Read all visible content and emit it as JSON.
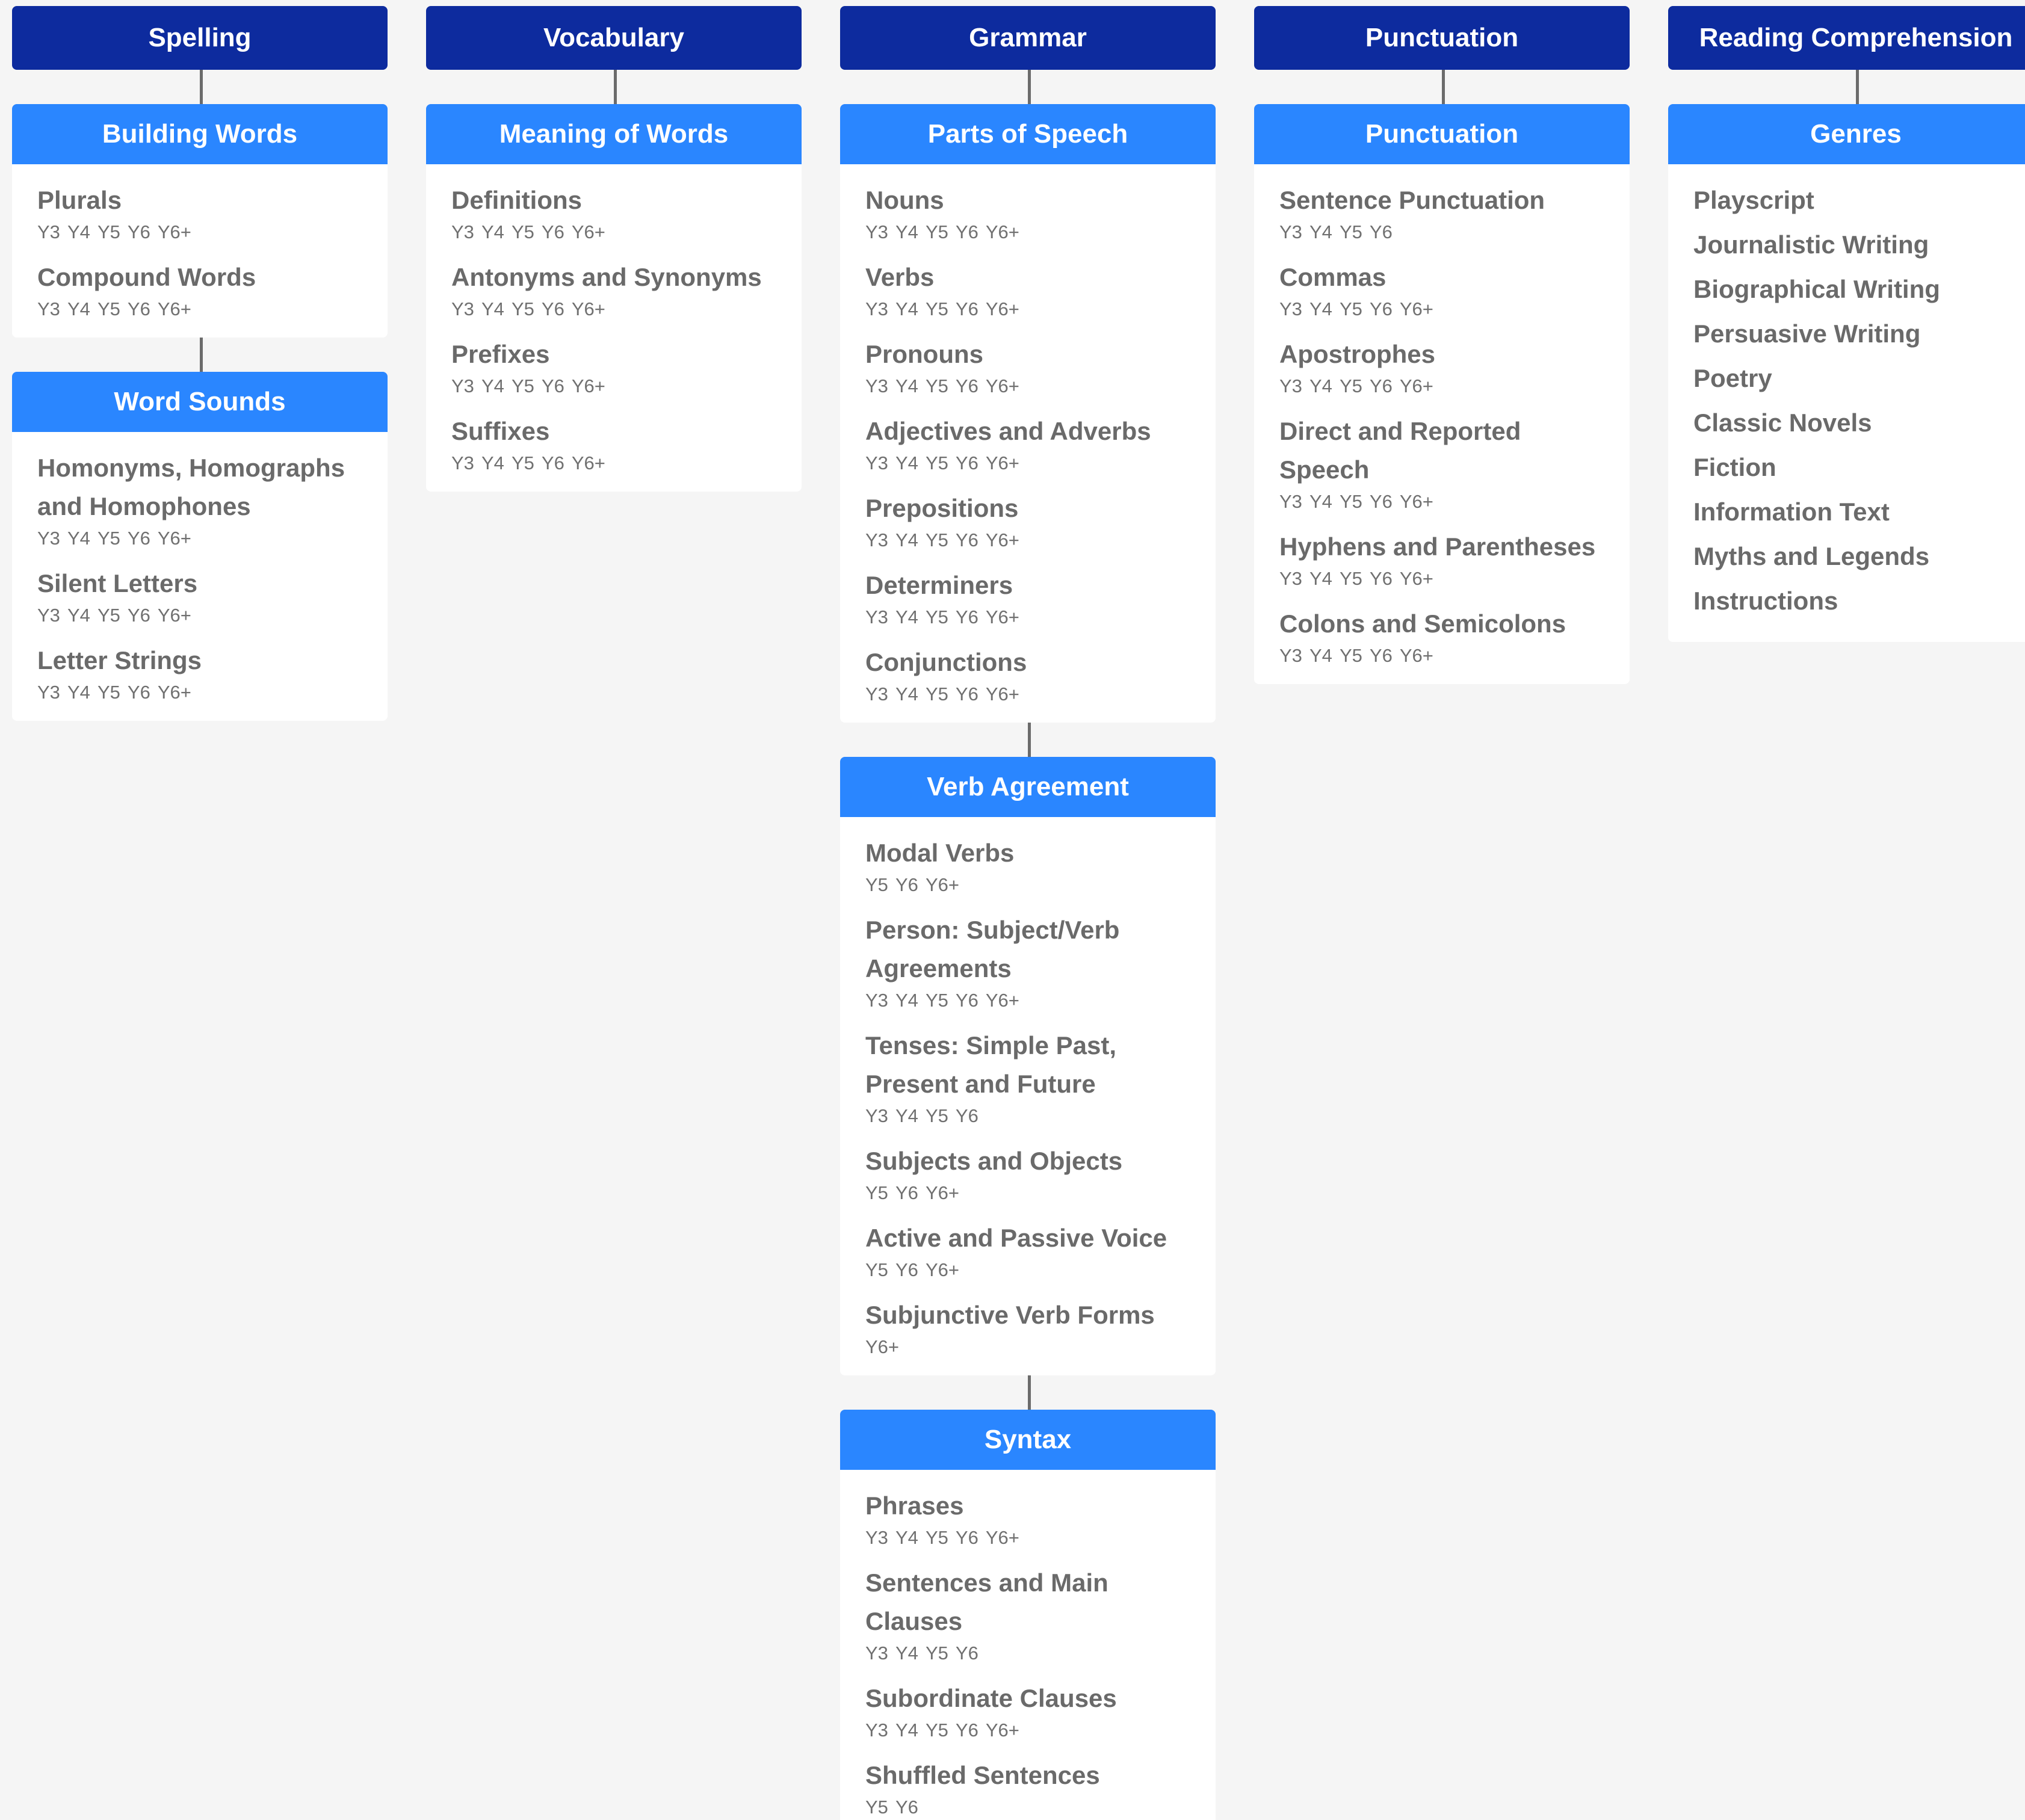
{
  "columns": [
    {
      "title": "Spelling",
      "cards": [
        {
          "title": "Building Words",
          "topics": [
            {
              "title": "Plurals",
              "years": "Y3 Y4 Y5 Y6 Y6+"
            },
            {
              "title": "Compound Words",
              "years": "Y3 Y4 Y5 Y6 Y6+"
            }
          ]
        },
        {
          "title": "Word Sounds",
          "topics": [
            {
              "title": "Homonyms, Homographs and Homophones",
              "years": "Y3 Y4 Y5 Y6 Y6+"
            },
            {
              "title": "Silent Letters",
              "years": "Y3 Y4 Y5 Y6 Y6+"
            },
            {
              "title": "Letter Strings",
              "years": "Y3 Y4 Y5 Y6 Y6+"
            }
          ]
        }
      ]
    },
    {
      "title": "Vocabulary",
      "cards": [
        {
          "title": "Meaning of Words",
          "topics": [
            {
              "title": "Definitions",
              "years": "Y3 Y4 Y5 Y6 Y6+"
            },
            {
              "title": "Antonyms and Synonyms",
              "years": "Y3 Y4 Y5 Y6 Y6+"
            },
            {
              "title": "Prefixes",
              "years": "Y3 Y4 Y5 Y6 Y6+"
            },
            {
              "title": "Suffixes",
              "years": "Y3 Y4 Y5 Y6 Y6+"
            }
          ]
        }
      ]
    },
    {
      "title": "Grammar",
      "cards": [
        {
          "title": "Parts of Speech",
          "topics": [
            {
              "title": "Nouns",
              "years": "Y3 Y4 Y5 Y6 Y6+"
            },
            {
              "title": "Verbs",
              "years": "Y3 Y4 Y5 Y6 Y6+"
            },
            {
              "title": "Pronouns",
              "years": "Y3 Y4 Y5 Y6 Y6+"
            },
            {
              "title": "Adjectives and Adverbs",
              "years": "Y3 Y4 Y5 Y6 Y6+"
            },
            {
              "title": "Prepositions",
              "years": "Y3 Y4 Y5 Y6 Y6+"
            },
            {
              "title": "Determiners",
              "years": "Y3 Y4 Y5 Y6 Y6+"
            },
            {
              "title": "Conjunctions",
              "years": "Y3 Y4 Y5 Y6 Y6+"
            }
          ]
        },
        {
          "title": "Verb Agreement",
          "topics": [
            {
              "title": "Modal Verbs",
              "years": "Y5 Y6 Y6+"
            },
            {
              "title": "Person: Subject/Verb Agreements",
              "years": "Y3 Y4 Y5 Y6 Y6+"
            },
            {
              "title": "Tenses: Simple Past, Present and Future",
              "years": "Y3 Y4 Y5 Y6"
            },
            {
              "title": "Subjects and Objects",
              "years": "Y5 Y6 Y6+"
            },
            {
              "title": "Active and Passive Voice",
              "years": "Y5 Y6 Y6+"
            },
            {
              "title": "Subjunctive Verb Forms",
              "years": "Y6+"
            }
          ]
        },
        {
          "title": "Syntax",
          "topics": [
            {
              "title": "Phrases",
              "years": "Y3 Y4 Y5 Y6 Y6+"
            },
            {
              "title": "Sentences and Main Clauses",
              "years": "Y3 Y4 Y5 Y6"
            },
            {
              "title": "Subordinate Clauses",
              "years": "Y3 Y4 Y5 Y6 Y6+"
            },
            {
              "title": "Shuffled Sentences",
              "years": "Y5 Y6"
            }
          ]
        }
      ]
    },
    {
      "title": "Punctuation",
      "cards": [
        {
          "title": "Punctuation",
          "topics": [
            {
              "title": "Sentence Punctuation",
              "years": "Y3 Y4 Y5 Y6"
            },
            {
              "title": "Commas",
              "years": "Y3 Y4 Y5 Y6 Y6+"
            },
            {
              "title": "Apostrophes",
              "years": "Y3 Y4 Y5 Y6 Y6+"
            },
            {
              "title": "Direct and Reported Speech",
              "years": "Y3 Y4 Y5 Y6 Y6+"
            },
            {
              "title": "Hyphens and Parentheses",
              "years": "Y3 Y4 Y5 Y6 Y6+"
            },
            {
              "title": "Colons and Semicolons",
              "years": "Y3 Y4 Y5 Y6 Y6+"
            }
          ]
        }
      ]
    },
    {
      "title": "Reading Comprehension",
      "cards": [
        {
          "title": "Genres",
          "topics": [
            {
              "title": "Playscript"
            },
            {
              "title": "Journalistic Writing"
            },
            {
              "title": "Biographical Writing"
            },
            {
              "title": "Persuasive Writing"
            },
            {
              "title": "Poetry"
            },
            {
              "title": "Classic Novels"
            },
            {
              "title": "Fiction"
            },
            {
              "title": "Information Text"
            },
            {
              "title": "Myths and Legends"
            },
            {
              "title": "Instructions"
            }
          ]
        }
      ]
    }
  ]
}
